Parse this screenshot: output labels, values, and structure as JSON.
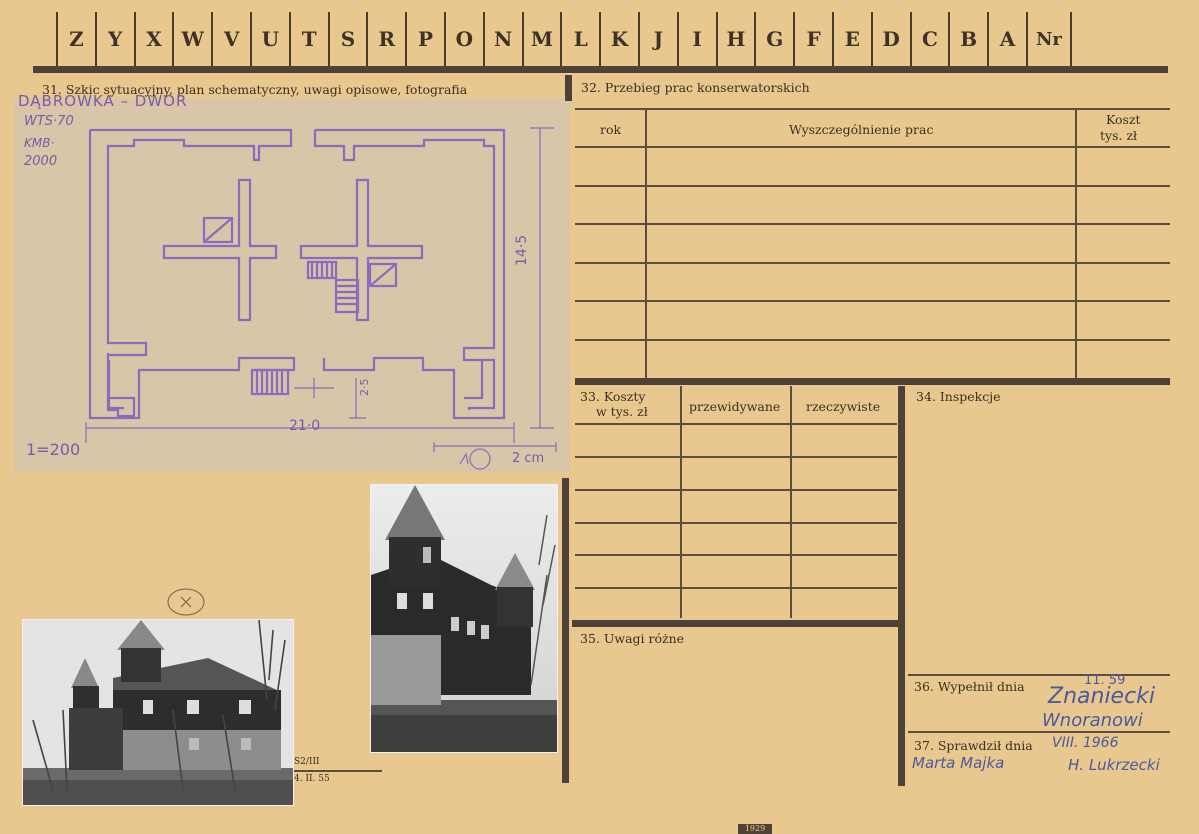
{
  "letters": [
    "Z",
    "Y",
    "X",
    "W",
    "V",
    "U",
    "T",
    "S",
    "R",
    "P",
    "O",
    "N",
    "M",
    "L",
    "K",
    "J",
    "I",
    "H",
    "G",
    "F",
    "E",
    "D",
    "C",
    "B",
    "A"
  ],
  "nr_label": "Nr",
  "section31": {
    "label": "31. Szkic sytuacyjny, plan schematyczny, uwagi opisowe, fotografia"
  },
  "section32": {
    "label": "32. Przebieg prac konserwatorskich",
    "col_rok": "rok",
    "col_wyszczegolnienie": "Wyszczególnienie prac",
    "col_koszt": "Koszt",
    "col_koszt_unit": "tys. zł"
  },
  "section33": {
    "label": "33. Koszty",
    "label2": "w tys. zł",
    "col_przewidywane": "przewidywane",
    "col_rzeczywiste": "rzeczywiste"
  },
  "section34": {
    "label": "34. Inspekcje"
  },
  "section35": {
    "label": "35. Uwagi różne"
  },
  "section36": {
    "label": "36. Wypełnił dnia",
    "hand_date": "11. 59",
    "hand_signature1": "Znaniecki",
    "hand_signature2": "Wnoranowi"
  },
  "section37": {
    "label": "37. Sprawdził dnia",
    "hand_date": "VIII. 1966",
    "hand_signature1": "Marta Majka",
    "hand_signature2": "H. Lukrzecki"
  },
  "sketch": {
    "title": "DĄBROWKA – DWOR",
    "note1": "WTS·70",
    "note2": "KMB·",
    "note3": "2000",
    "dim_width": "21·0",
    "dim_depth": "14·5",
    "dim_small": "2·5",
    "scale": "1=200",
    "scale_bar": "2 cm"
  },
  "print_code": "S2/III",
  "print_date": "4. II. 55",
  "bottom_mark": "1929"
}
